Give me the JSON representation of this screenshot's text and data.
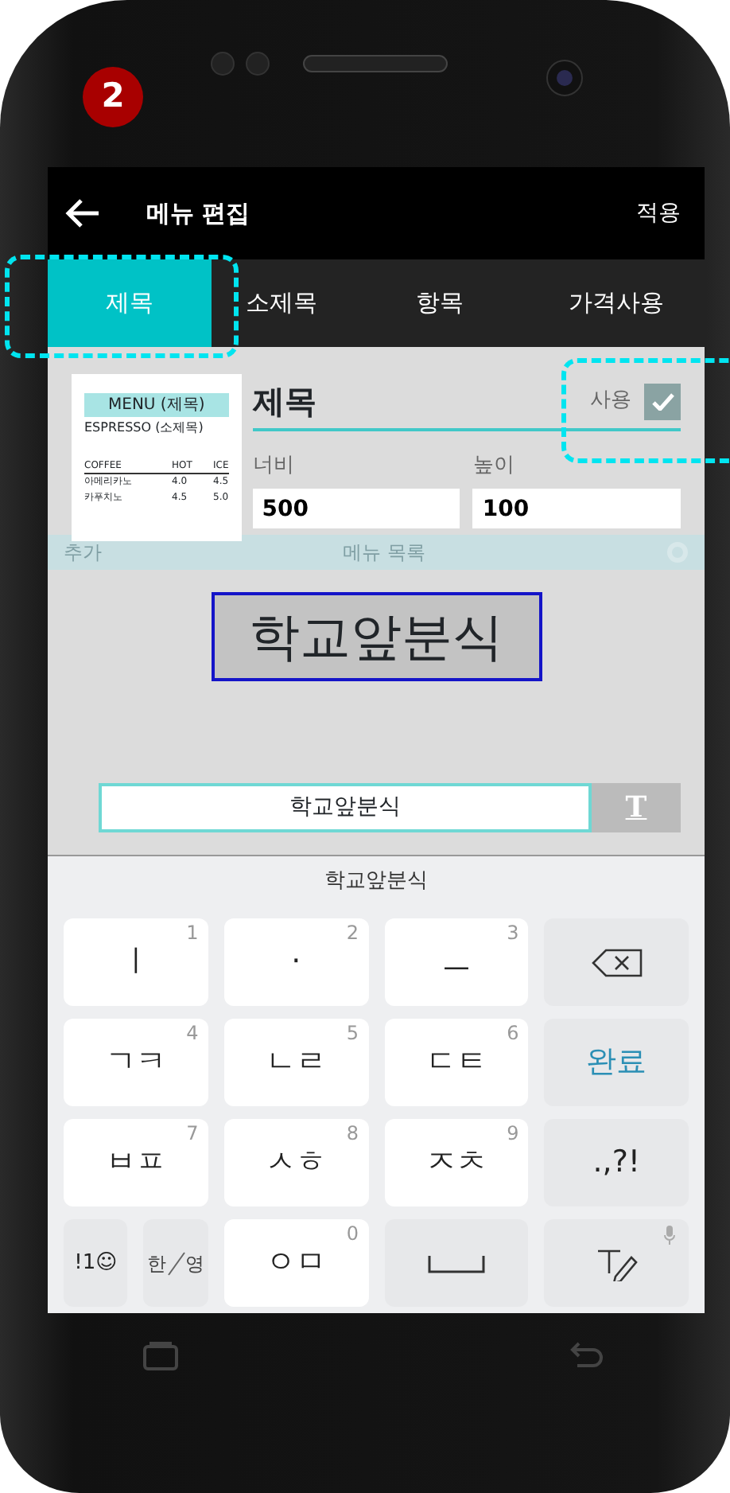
{
  "annotation_badge": "2",
  "app_bar": {
    "title": "메뉴 편집",
    "action": "적용"
  },
  "tabs": [
    {
      "label": "제목",
      "selected": true,
      "highlighted": true
    },
    {
      "label": "소제목",
      "selected": false,
      "highlighted": false
    },
    {
      "label": "항목",
      "selected": false,
      "highlighted": false
    },
    {
      "label": "가격사용",
      "selected": false,
      "highlighted": false
    }
  ],
  "preview_card": {
    "title": "MENU (제목)",
    "subtitle": "ESPRESSO (소제목)",
    "columns": [
      "COFFEE",
      "HOT",
      "ICE"
    ],
    "rows": [
      [
        "아메리카노",
        "4.0",
        "4.5"
      ],
      [
        "카푸치노",
        "4.5",
        "5.0"
      ]
    ]
  },
  "editor": {
    "heading": "제목",
    "use_label": "사용",
    "use_checked": true,
    "use_highlighted": true,
    "width_label": "너비",
    "width_value": "500",
    "height_label": "높이",
    "height_value": "100"
  },
  "background_bar": {
    "add_label": "추가",
    "title": "메뉴 목록"
  },
  "title_preview": "학교앞분식",
  "text_input": {
    "value": "학교앞분식",
    "font_button": "T"
  },
  "keyboard": {
    "suggestion": "학교앞분식",
    "rows": [
      [
        {
          "kind": "char",
          "label": "ㅣ",
          "number": "1"
        },
        {
          "kind": "char",
          "label": "·",
          "number": "2"
        },
        {
          "kind": "char",
          "label": "ㅡ",
          "number": "3"
        },
        {
          "kind": "backspace"
        }
      ],
      [
        {
          "kind": "char",
          "label": "ㄱㅋ",
          "number": "4"
        },
        {
          "kind": "char",
          "label": "ㄴㄹ",
          "number": "5"
        },
        {
          "kind": "char",
          "label": "ㄷㅌ",
          "number": "6"
        },
        {
          "kind": "action",
          "label": "완료"
        }
      ],
      [
        {
          "kind": "char",
          "label": "ㅂㅍ",
          "number": "7"
        },
        {
          "kind": "char",
          "label": "ㅅㅎ",
          "number": "8"
        },
        {
          "kind": "char",
          "label": "ㅈㅊ",
          "number": "9"
        },
        {
          "kind": "special",
          "label": ".,?!"
        }
      ],
      [
        {
          "kind": "pair",
          "keys": [
            {
              "kind": "small",
              "label": "!1☺"
            },
            {
              "kind": "lang",
              "label": "한",
              "sublabel": "영"
            }
          ]
        },
        {
          "kind": "char",
          "label": "ㅇㅁ",
          "number": "0"
        },
        {
          "kind": "space"
        },
        {
          "kind": "handwriting"
        }
      ]
    ]
  }
}
